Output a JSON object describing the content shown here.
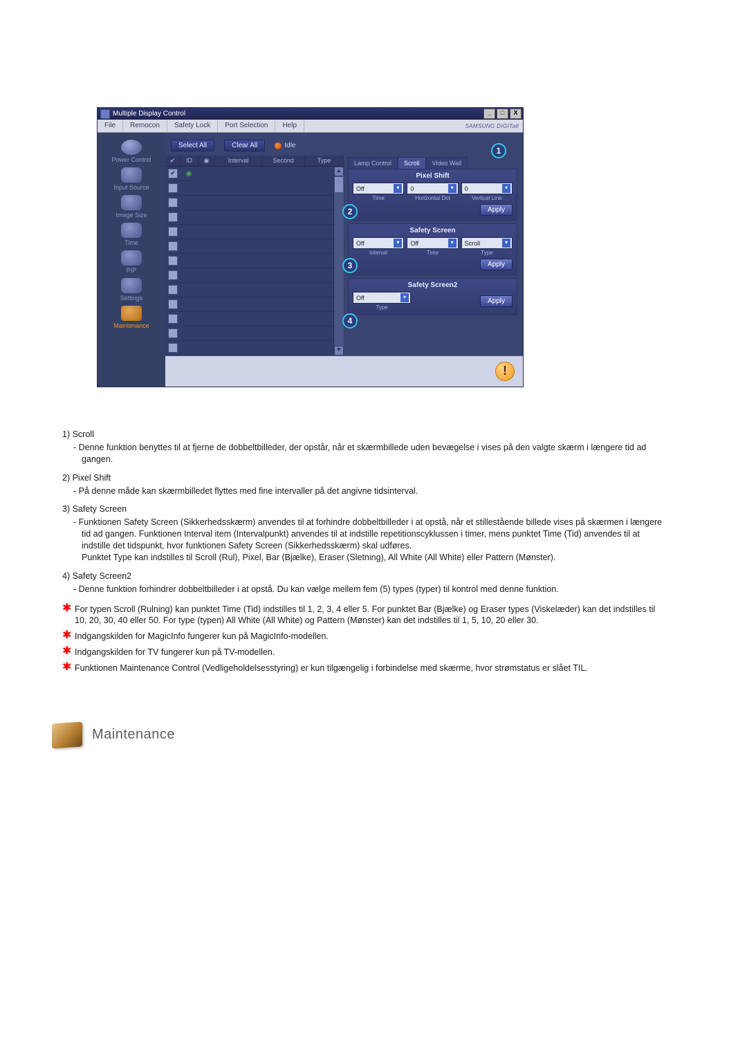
{
  "appWindow": {
    "title": "Multiple Display Control",
    "menu": {
      "file": "File",
      "remocon": "Remocon",
      "safety": "Safety Lock",
      "port": "Port Selection",
      "help": "Help"
    },
    "brand": "SAMSUNG DIGITall",
    "sidebar": {
      "power": "Power Control",
      "input": "Input Source",
      "image": "Image Size",
      "time": "Time",
      "pip": "PIP",
      "settings": "Settings",
      "maintenance": "Maintenance"
    },
    "buttons": {
      "selectAll": "Select All",
      "clearAll": "Clear All"
    },
    "idle": "Idle",
    "gridHeaders": {
      "id": "ID",
      "interval": "Interval",
      "second": "Second",
      "type": "Type"
    },
    "tabs": {
      "lamp": "Lamp Control",
      "scroll": "Scroll",
      "video": "Video Wall"
    },
    "numbers": {
      "n1": "1",
      "n2": "2",
      "n3": "3",
      "n4": "4"
    },
    "pixelShift": {
      "title": "Pixel Shift",
      "time": "Off",
      "hDot": "0",
      "vLine": "0",
      "labels": {
        "time": "Time",
        "hDot": "Horizontal Dot",
        "vLine": "Vertical Line"
      },
      "apply": "Apply"
    },
    "safetyScreen": {
      "title": "Safety Screen",
      "interval": "Off",
      "time": "Off",
      "type": "Scroll",
      "labels": {
        "interval": "Interval",
        "time": "Time",
        "type": "Type"
      },
      "apply": "Apply"
    },
    "safetyScreen2": {
      "title": "Safety Screen2",
      "type": "Off",
      "labels": {
        "type": "Type"
      },
      "apply": "Apply"
    },
    "winBtns": {
      "min": "_",
      "max": "□",
      "close": "X"
    },
    "scroll": {
      "up": "▲",
      "down": "▼"
    }
  },
  "dropdownArrow": "▾",
  "textSection": {
    "items": [
      {
        "title": "1)  Scroll",
        "body": "- Denne funktion benyttes til at fjerne de dobbeltbilleder, der opstår, når et skærmbillede uden bevægelse i vises på den valgte skærm i længere tid ad gangen."
      },
      {
        "title": "2)  Pixel Shift",
        "body": "- På denne måde kan skærmbilledet flyttes med fine intervaller på det angivne tidsinterval."
      },
      {
        "title": "3)  Safety Screen",
        "body": "- Funktionen Safety Screen (Sikkerhedsskærm) anvendes til at forhindre dobbeltbilleder i at opstå, når et stillestående billede vises på skærmen i længere tid ad gangen.  Funktionen Interval item (Intervalpunkt) anvendes til at indstille repetitionscyklussen i timer, mens punktet Time (Tid) anvendes til at indstille det tidspunkt, hvor funktionen Safety Screen (Sikkerhedsskærm) skal udføres.\nPunktet Type kan indstilles til Scroll (Rul), Pixel, Bar (Bjælke), Eraser (Sletning), All White (All White) eller Pattern (Mønster)."
      },
      {
        "title": "4)  Safety Screen2",
        "body": "- Denne funktion forhindrer dobbeltbilleder i at opstå. Du kan vælge mellem fem (5) types (typer) til kontrol med denne funktion."
      }
    ],
    "stars": [
      "For typen Scroll (Rulning) kan punktet Time (Tid) indstilles til 1, 2, 3, 4 eller 5. For punktet Bar (Bjælke) og Eraser types (Viskelæder) kan det indstilles til 10, 20, 30, 40 eller 50. For type (typen) All White (All White) og Pattern (Mønster) kan det indstilles til 1, 5, 10, 20 eller 30.",
      "Indgangskilden for MagicInfo fungerer kun på MagicInfo-modellen.",
      "Indgangskilden for TV fungerer kun på TV-modellen.",
      "Funktionen Maintenance Control (Vedligeholdelsesstyring) er kun tilgængelig i forbindelse med skærme, hvor strømstatus er slået TIL."
    ]
  },
  "sectionHeading": "Maintenance",
  "star": "✱",
  "infoGlyph": "!"
}
